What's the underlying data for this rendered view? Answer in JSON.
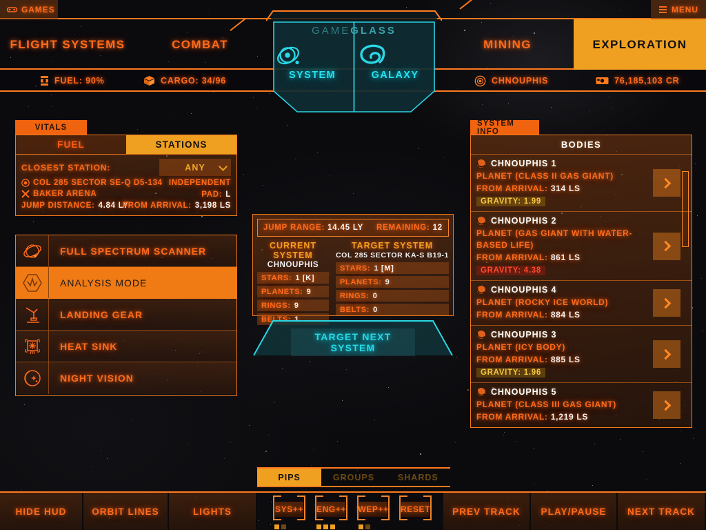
{
  "topbar": {
    "games_label": "GAMES",
    "games_icon": "gamepad-icon",
    "menu_label": "MENU",
    "menu_icon": "hamburger-icon"
  },
  "nav": {
    "items": [
      {
        "label": "FLIGHT SYSTEMS",
        "active": false
      },
      {
        "label": "COMBAT",
        "active": false
      },
      {
        "label": "MINING",
        "active": false
      },
      {
        "label": "EXPLORATION",
        "active": true
      }
    ]
  },
  "brand": {
    "part1": "GAME",
    "part2": "GLASS"
  },
  "hex_tabs": [
    {
      "label": "SYSTEM",
      "icon": "orbit-system-icon"
    },
    {
      "label": "GALAXY",
      "icon": "galaxy-spiral-icon"
    }
  ],
  "status": {
    "fuel": "FUEL: 90%",
    "fuel_icon": "fuel-canister-icon",
    "cargo": "CARGO: 34/96",
    "cargo_icon": "cargo-box-icon",
    "system": "CHNOUPHIS",
    "system_icon": "system-target-icon",
    "credits": "76,185,103 CR",
    "credits_icon": "credits-icon"
  },
  "vitals": {
    "tab_label": "VITALS",
    "tabs": [
      {
        "label": "FUEL",
        "active": false
      },
      {
        "label": "STATIONS",
        "active": true
      }
    ],
    "closest_station_label": "CLOSEST STATION:",
    "filter_value": "ANY",
    "station": {
      "system_name": "COL 285 SECTOR SE-Q D5-134",
      "system_icon": "station-system-icon",
      "station_name": "BAKER ARENA",
      "station_icon": "outpost-icon",
      "allegiance": "INDEPENDENT",
      "pad_label": "PAD:",
      "pad_value": "L",
      "from_arrival_label": "FROM ARRIVAL:",
      "from_arrival_value": "3,198 LS",
      "jump_distance_label": "JUMP DISTANCE:",
      "jump_distance_value": "4.84 LY"
    }
  },
  "toggle_buttons": [
    {
      "label": "FULL SPECTRUM SCANNER",
      "icon": "spectrum-scanner-icon",
      "active": false
    },
    {
      "label": "ANALYSIS MODE",
      "icon": "analysis-hex-icon",
      "active": true
    },
    {
      "label": "LANDING GEAR",
      "icon": "landing-gear-icon",
      "active": false
    },
    {
      "label": "HEAT SINK",
      "icon": "heat-sink-icon",
      "active": false
    },
    {
      "label": "NIGHT VISION",
      "icon": "night-vision-icon",
      "active": false
    }
  ],
  "nav_info": {
    "jump_range_label": "JUMP RANGE:",
    "jump_range_value": "14.45 LY",
    "remaining_label": "REMAINING:",
    "remaining_value": "12",
    "current": {
      "heading": "CURRENT SYSTEM",
      "name": "CHNOUPHIS",
      "rows": [
        {
          "label": "STARS:",
          "value": "1 [K]"
        },
        {
          "label": "PLANETS:",
          "value": "9"
        },
        {
          "label": "RINGS:",
          "value": "9"
        },
        {
          "label": "BELTS:",
          "value": "1"
        }
      ]
    },
    "target": {
      "heading": "TARGET SYSTEM",
      "name": "COL 285 SECTOR KA-S B19-1",
      "rows": [
        {
          "label": "STARS:",
          "value": "1 [M]"
        },
        {
          "label": "PLANETS:",
          "value": "9"
        },
        {
          "label": "RINGS:",
          "value": "0"
        },
        {
          "label": "BELTS:",
          "value": "0"
        }
      ]
    },
    "target_button": "TARGET NEXT SYSTEM"
  },
  "system_info": {
    "tab_label": "SYSTEM INFO",
    "header": "BODIES",
    "arrival_label": "FROM ARRIVAL:",
    "gravity_label": "GRAVITY:",
    "bodies": [
      {
        "name": "CHNOUPHIS 1",
        "type": "PLANET (CLASS II GAS GIANT)",
        "arrival": "314 LS",
        "gravity": "1.99",
        "gravity_level": "warn"
      },
      {
        "name": "CHNOUPHIS 2",
        "type": "PLANET (GAS GIANT WITH WATER-BASED LIFE)",
        "arrival": "861 LS",
        "gravity": "4.38",
        "gravity_level": "danger"
      },
      {
        "name": "CHNOUPHIS 4",
        "type": "PLANET (ROCKY ICE WORLD)",
        "arrival": "884 LS",
        "gravity": null,
        "gravity_level": null
      },
      {
        "name": "CHNOUPHIS 3",
        "type": "PLANET (ICY BODY)",
        "arrival": "885 LS",
        "gravity": "1.96",
        "gravity_level": "warn"
      },
      {
        "name": "CHNOUPHIS 5",
        "type": "PLANET (CLASS III GAS GIANT)",
        "arrival": "1,219 LS",
        "gravity": null,
        "gravity_level": null
      }
    ]
  },
  "bottom": {
    "left_buttons": [
      "HIDE HUD",
      "ORBIT LINES",
      "LIGHTS"
    ],
    "pip_tabs": [
      {
        "label": "PIPS",
        "active": true
      },
      {
        "label": "GROUPS",
        "active": false
      },
      {
        "label": "SHARDS",
        "active": false
      }
    ],
    "pip_buttons": [
      {
        "label": "SYS++",
        "pips": 2,
        "max": 4
      },
      {
        "label": "ENG++",
        "pips": 3,
        "max": 3
      },
      {
        "label": "WEP++",
        "pips": 2,
        "max": 4
      },
      {
        "label": "RESET",
        "pips": 0,
        "max": 0
      }
    ],
    "right_buttons": [
      "PREV TRACK",
      "PLAY/PAUSE",
      "NEXT TRACK"
    ]
  },
  "colors": {
    "accent_amber": "#f0a020",
    "accent_orange": "#ff6a1a",
    "border_orange": "#ff7a1e",
    "cyan": "#29e0ee",
    "brand_teal": "#37a3ab",
    "danger_red": "#ff4a2a",
    "warn_yellow": "#f5c542",
    "background": "#0b0b0e"
  }
}
